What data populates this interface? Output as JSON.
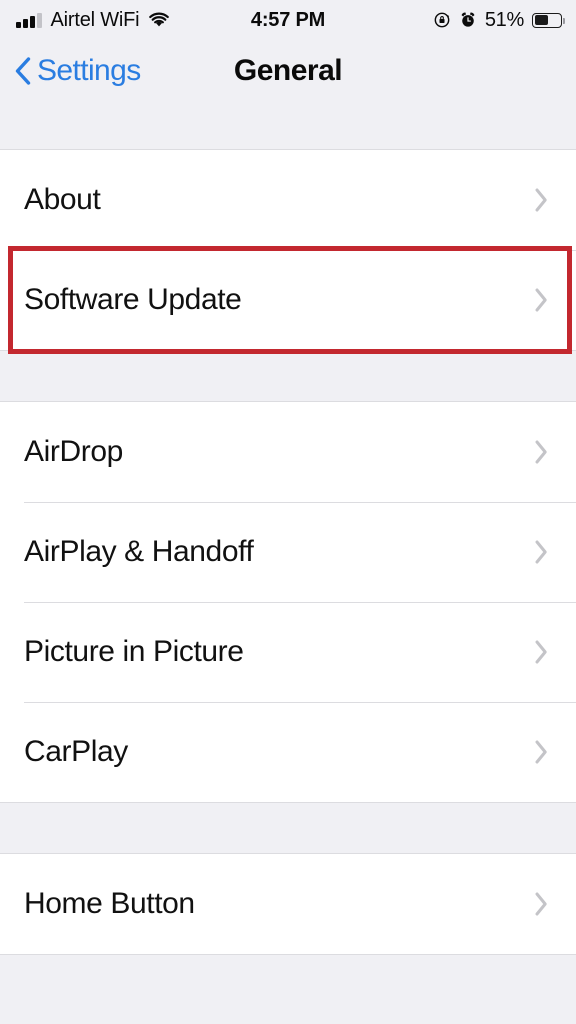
{
  "status_bar": {
    "carrier": "Airtel WiFi",
    "signal_bars_filled": 3,
    "signal_bars_total": 4,
    "wifi_icon": "wifi-icon",
    "time": "4:57 PM",
    "rotation_lock_icon": "rotation-lock-icon",
    "alarm_icon": "alarm-clock-icon",
    "battery_percent": "51%",
    "battery_level": 51
  },
  "nav_bar": {
    "back_icon": "chevron-left-icon",
    "back_label": "Settings",
    "title": "General"
  },
  "colors": {
    "accent_blue": "#2a7de1",
    "highlight_red": "#c3282f",
    "background_gray": "#f0f0f4",
    "row_white": "#ffffff",
    "separator": "#dcdce0",
    "chevron_gray": "#c4c4c8"
  },
  "sections": [
    {
      "rows": [
        {
          "label": "About",
          "chevron": "chevron-right-icon",
          "highlighted": false
        },
        {
          "label": "Software Update",
          "chevron": "chevron-right-icon",
          "highlighted": true
        }
      ]
    },
    {
      "rows": [
        {
          "label": "AirDrop",
          "chevron": "chevron-right-icon",
          "highlighted": false
        },
        {
          "label": "AirPlay & Handoff",
          "chevron": "chevron-right-icon",
          "highlighted": false
        },
        {
          "label": "Picture in Picture",
          "chevron": "chevron-right-icon",
          "highlighted": false
        },
        {
          "label": "CarPlay",
          "chevron": "chevron-right-icon",
          "highlighted": false
        }
      ]
    },
    {
      "rows": [
        {
          "label": "Home Button",
          "chevron": "chevron-right-icon",
          "highlighted": false
        }
      ]
    }
  ]
}
